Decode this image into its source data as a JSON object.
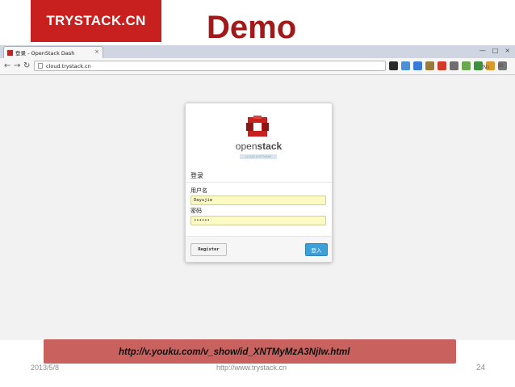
{
  "slide": {
    "brand": "TRYSTACK.CN",
    "title": "Demo",
    "video_url": "http://v.youku.com/v_show/id_XNTMyMzA3NjIw.html",
    "footer": {
      "date": "2013/5/8",
      "site": "http://www.trystack.cn",
      "page_number": "24"
    }
  },
  "browser": {
    "tab_title": "登录 - OpenStack Dash",
    "address": "cloud.trystack.cn",
    "extension_icons": [
      {
        "name": "user-icon",
        "color": "#2b2b2b"
      },
      {
        "name": "bird-icon",
        "color": "#4b8fd6"
      },
      {
        "name": "translate-icon",
        "color": "#3a7bd5"
      },
      {
        "name": "puzzle-icon",
        "color": "#9a7a3b"
      },
      {
        "name": "opera-icon",
        "color": "#d23a2a"
      },
      {
        "name": "print-icon",
        "color": "#6f6f6f"
      },
      {
        "name": "note-icon",
        "color": "#6aa84f"
      },
      {
        "name": "sheet-icon",
        "color": "#3f8f3f"
      },
      {
        "name": "map-icon",
        "color": "#d89a2b"
      },
      {
        "name": "lines-icon",
        "color": "#777777"
      }
    ],
    "ext_label": "N₃",
    "menu_icon": "≡"
  },
  "login": {
    "logo_word_light": "open",
    "logo_word_bold": "stack",
    "logo_tag": "CLOUD SOFTWARE",
    "title": "登录",
    "username_label": "用户名",
    "username_value": "Dayujie",
    "password_label": "密码",
    "password_value": "••••••",
    "register_label": "Register",
    "login_label": "登入"
  },
  "colors": {
    "brand_red": "#c8201e",
    "title_red": "#a11a19",
    "banner": "#c9625f",
    "login_blue": "#3d9fd8",
    "autofill": "#fbfbc3"
  }
}
